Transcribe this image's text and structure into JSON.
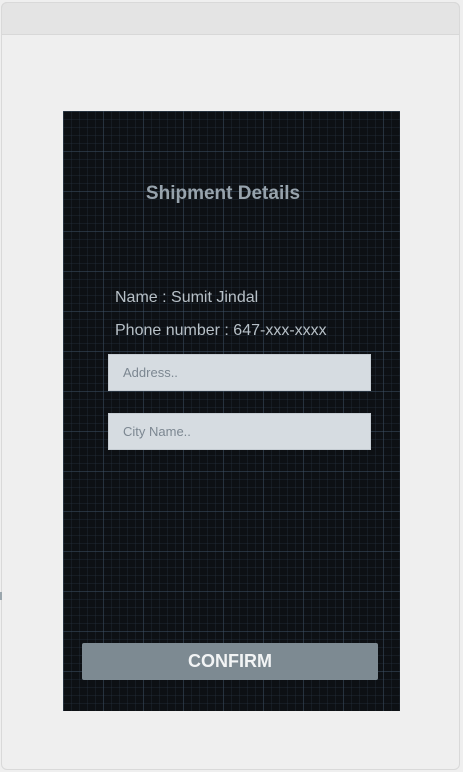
{
  "screen": {
    "title": "Shipment Details",
    "name_line": "Name : Sumit Jindal",
    "phone_line": "Phone number : 647-xxx-xxxx",
    "address_placeholder": "Address..",
    "city_placeholder": "City Name..",
    "confirm_label": "CONFIRM"
  },
  "colors": {
    "background": "#0d1014",
    "input_background": "#d6dce1",
    "button_background": "#7d8a92",
    "title_text": "#97a3ad"
  }
}
